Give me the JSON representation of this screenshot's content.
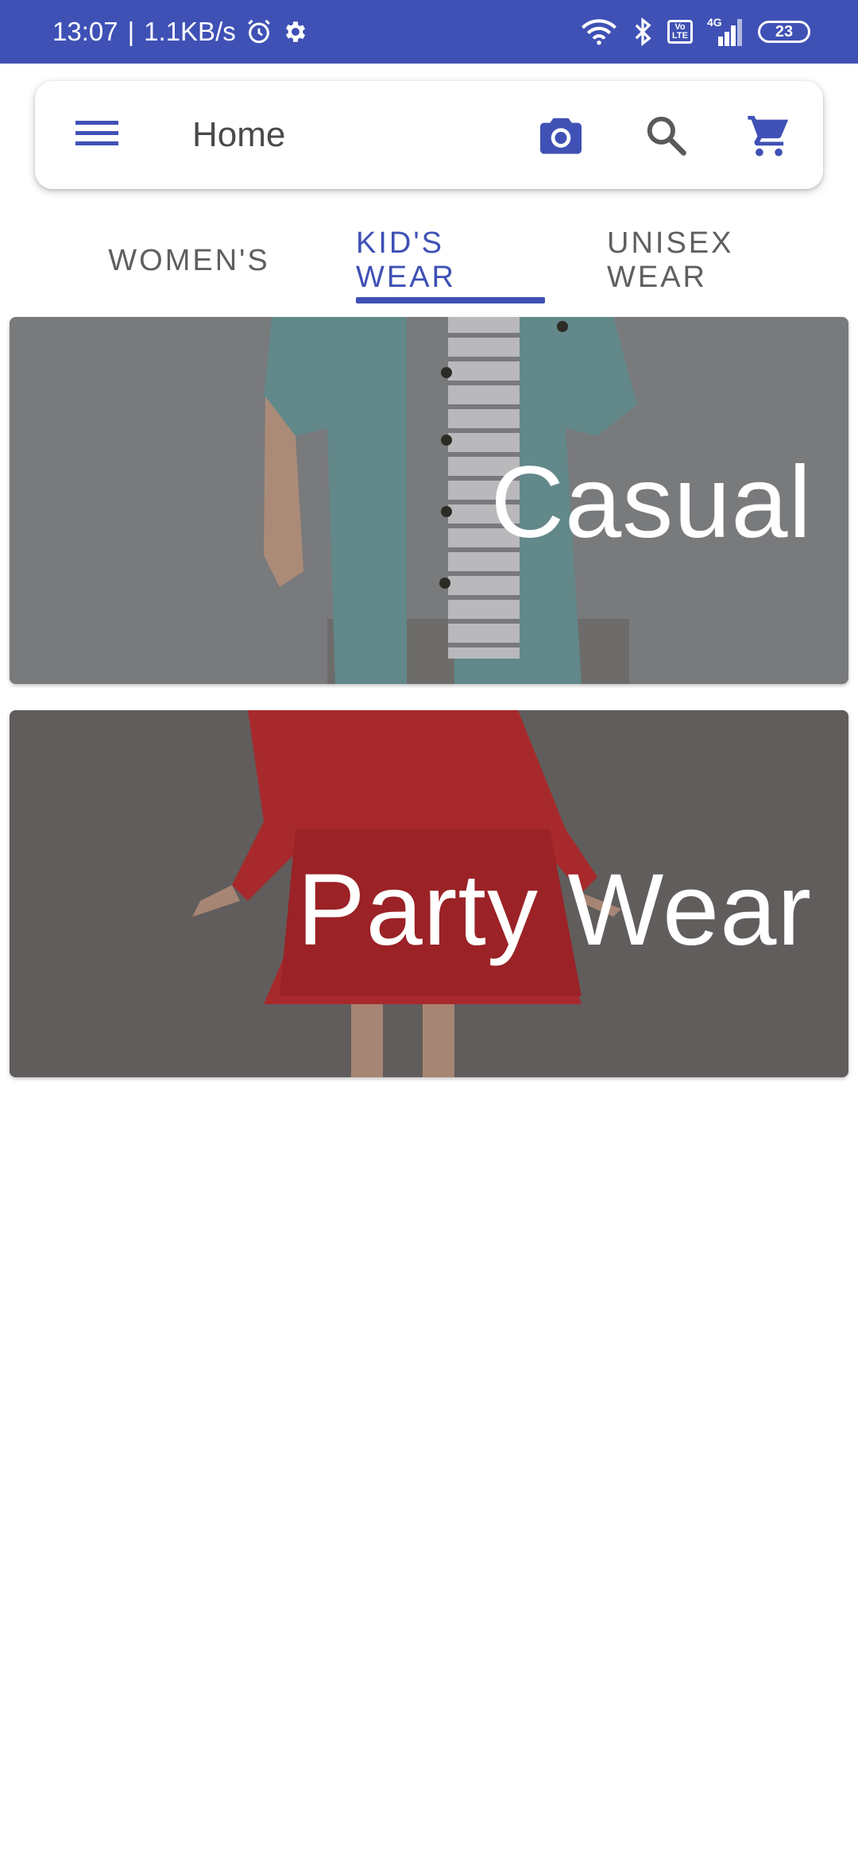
{
  "status_bar": {
    "time": "13:07",
    "network_speed": "1.1KB/s",
    "separator": "|",
    "volte_top": "Vo",
    "volte_bottom": "LTE",
    "network_type": "4G",
    "battery_level": "23",
    "icons": [
      "alarm-icon",
      "settings-icon",
      "wifi-icon",
      "bluetooth-icon",
      "volte-icon",
      "signal-icon",
      "battery-icon"
    ]
  },
  "toolbar": {
    "menu_icon": "hamburger-menu-icon",
    "title": "Home",
    "camera_icon": "camera-icon",
    "search_icon": "search-icon",
    "cart_icon": "shopping-cart-icon"
  },
  "tabs": [
    {
      "label": "WOMEN'S",
      "active": false
    },
    {
      "label": "KID'S WEAR",
      "active": true
    },
    {
      "label": "UNISEX WEAR",
      "active": false
    }
  ],
  "categories": [
    {
      "label": "Casual"
    },
    {
      "label": "Party Wear"
    }
  ],
  "colors": {
    "primary": "#3f51b5",
    "tab_inactive": "#5f5f5f",
    "background": "#ffffff"
  }
}
